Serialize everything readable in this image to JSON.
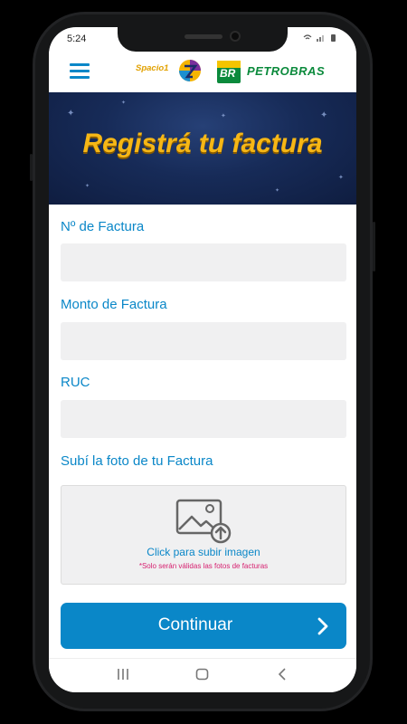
{
  "status_bar": {
    "time": "5:24",
    "icons": "wifi-icon signal-icon battery-icon"
  },
  "header": {
    "menu_icon": "hamburger-menu-icon",
    "brand_left": "Spacio1",
    "brand_badge": "BR",
    "brand_right": "PETROBRAS",
    "colors": {
      "accent": "#0a87c8",
      "petrobras_green": "#0b8a3c",
      "petrobras_yellow": "#f4c400"
    }
  },
  "banner": {
    "title": "Registrá tu factura",
    "title_color": "#f6b716"
  },
  "form": {
    "invoice_number": {
      "label": "Nº de Factura",
      "value": ""
    },
    "invoice_amount": {
      "label": "Monto de Factura",
      "value": ""
    },
    "ruc": {
      "label": "RUC",
      "value": ""
    },
    "photo": {
      "label": "Subí la foto de tu Factura",
      "upload_text": "Click para subir imagen",
      "note": "*Solo serán válidas las fotos de facturas",
      "icon": "image-upload-icon"
    }
  },
  "continue_button": {
    "label": "Continuar",
    "icon": "chevron-right-icon"
  },
  "navbar": {
    "recent": "recent-apps-icon",
    "home": "home-icon",
    "back": "back-icon"
  }
}
